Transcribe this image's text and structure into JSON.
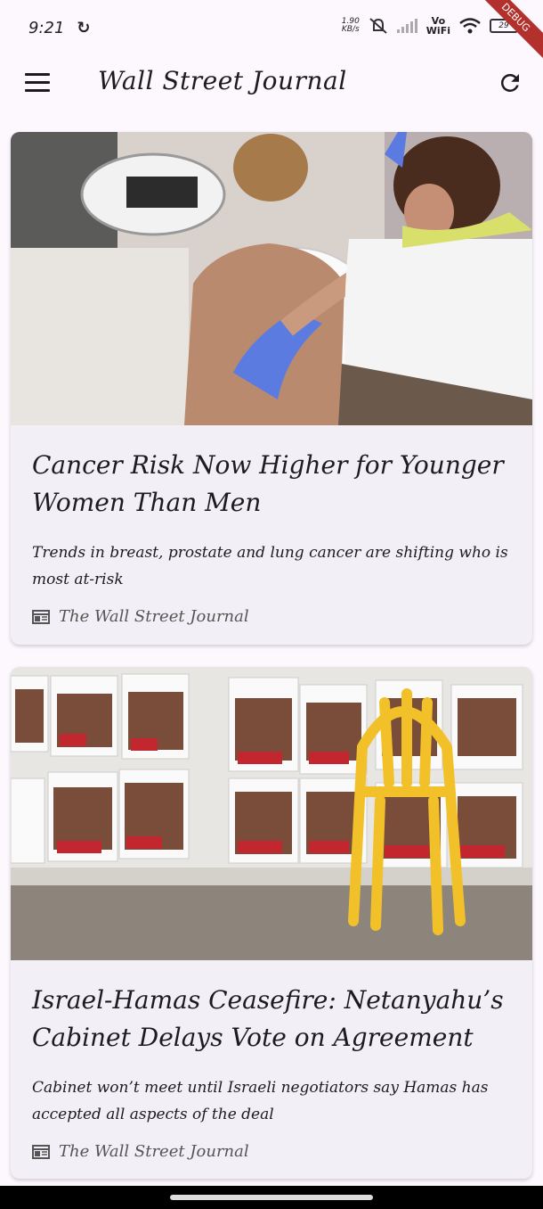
{
  "status": {
    "time": "9:21",
    "net_speed_value": "1.90",
    "net_speed_unit": "KB/s",
    "vowifi_top": "Vo",
    "vowifi_bottom": "WiFi",
    "battery": "29"
  },
  "debug_banner": "DEBUG",
  "app_bar": {
    "title": "Wall Street Journal"
  },
  "articles": [
    {
      "title": "Cancer Risk Now Higher for Younger Women Than Men",
      "description": "Trends in breast, prostate and lung cancer are shifting who is most at-risk",
      "source": "The Wall Street Journal",
      "image_icon": "mammogram-photo"
    },
    {
      "title": "Israel-Hamas Ceasefire: Netanyahu’s Cabinet Delays Vote on Agreement",
      "description": "Cabinet won’t meet until Israeli negotiators say Hamas has accepted all aspects of the deal",
      "source": "The Wall Street Journal",
      "image_icon": "hostage-posters-chair-photo"
    }
  ],
  "colors": {
    "background": "#fdf7fe",
    "card": "#f3eff6",
    "text": "#1d1b20"
  }
}
